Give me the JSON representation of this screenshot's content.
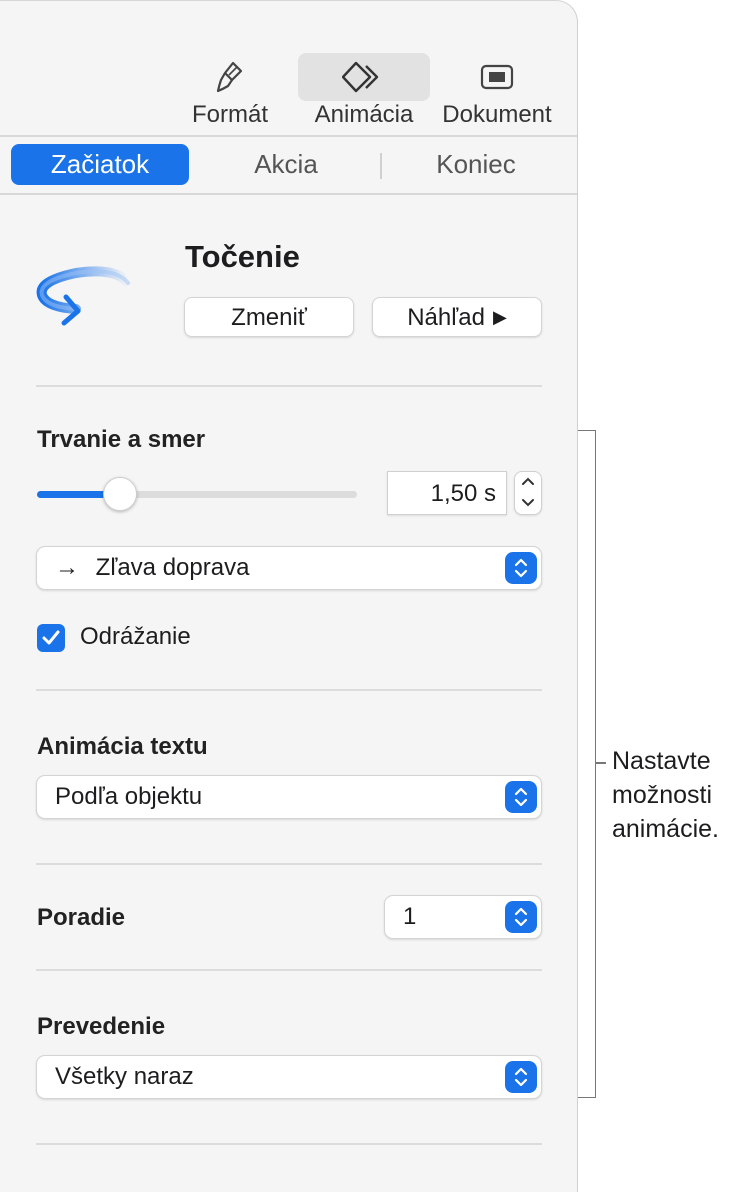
{
  "toolbar": {
    "format_label": "Formát",
    "animation_label": "Animácia",
    "document_label": "Dokument"
  },
  "tabs": {
    "start": "Začiatok",
    "action": "Akcia",
    "end": "Koniec",
    "active": "start"
  },
  "effect": {
    "title": "Točenie",
    "change_label": "Zmeniť",
    "preview_label": "Náhľad",
    "icon": "spin-arrow-icon"
  },
  "duration": {
    "label": "Trvanie a smer",
    "value": "1,50 s",
    "slider_fraction": 0.26,
    "direction_arrow": "→",
    "direction": "Zľava doprava"
  },
  "bounce": {
    "label": "Odrážanie",
    "checked": true
  },
  "text_animation": {
    "label": "Animácia textu",
    "value": "Podľa objektu"
  },
  "order": {
    "label": "Poradie",
    "value": "1"
  },
  "delivery": {
    "label": "Prevedenie",
    "value": "Všetky naraz"
  },
  "callout": {
    "lines": [
      "Nastavte",
      "možnosti",
      "animácie."
    ]
  },
  "colors": {
    "accent": "#1a73e8"
  }
}
